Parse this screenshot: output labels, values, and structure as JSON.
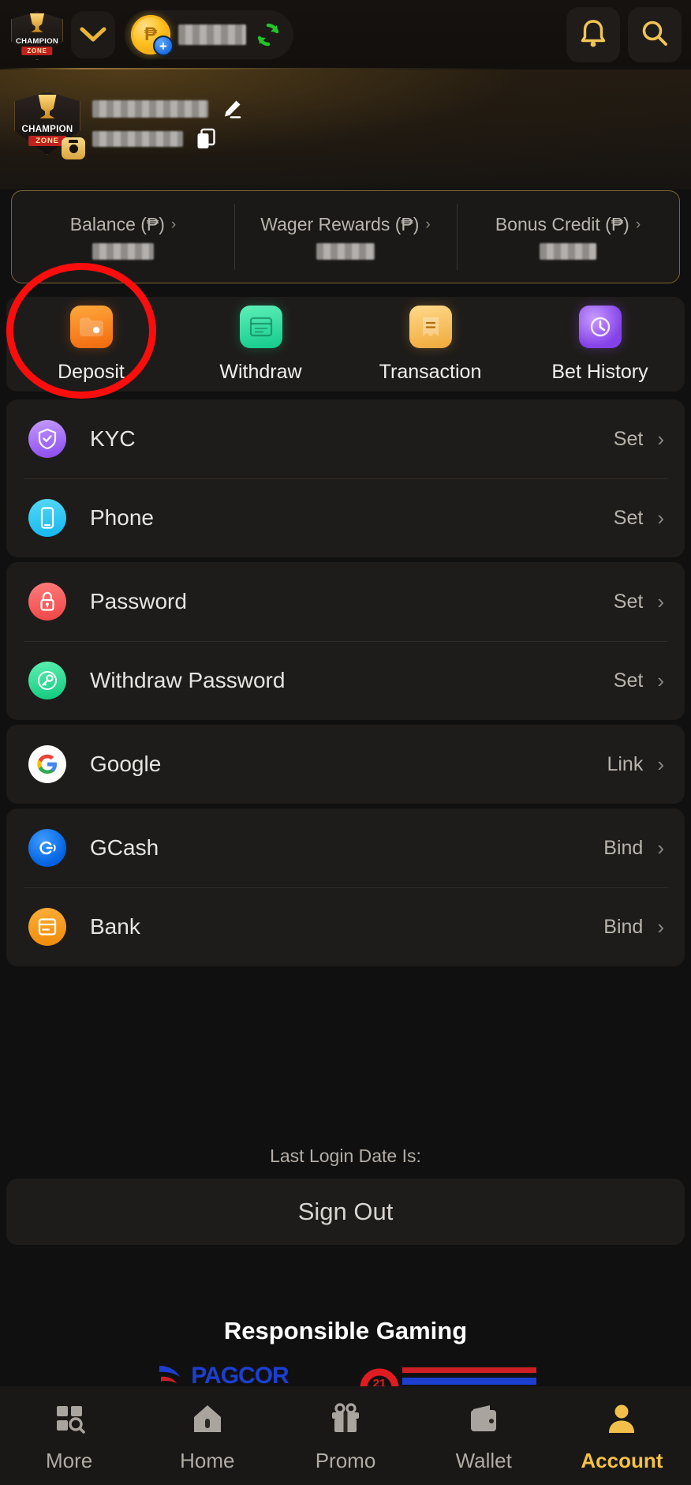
{
  "app": {
    "brand_name": "CHAMPION",
    "brand_sub": "ZONE",
    "currency_symbol": "₱",
    "accent_gold": "#f5c243",
    "annotation_color": "#f90d0d"
  },
  "topbar": {
    "brand_logo_label": "CHAMPION ZONE",
    "dropdown_label": "chevron-down",
    "wallet": {
      "coin_symbol": "₱",
      "add_badge": "+",
      "amount_value": "",
      "refresh_label": "refresh"
    },
    "notification_label": "notifications",
    "search_label": "search"
  },
  "profile": {
    "avatar_label": "CHAMPION ZONE",
    "camera_label": "change avatar",
    "username": "",
    "user_id": "",
    "edit_label": "edit nickname",
    "copy_label": "copy user id"
  },
  "balance_card": {
    "cells": [
      {
        "label": "Balance (₱)",
        "chevron": "›",
        "value": ""
      },
      {
        "label": "Wager Rewards (₱)",
        "chevron": "›",
        "value": ""
      },
      {
        "label": "Bonus Credit (₱)",
        "chevron": "›",
        "value": ""
      }
    ]
  },
  "quick_actions": [
    {
      "label": "Deposit",
      "icon": "wallet-deposit-icon",
      "highlighted": true
    },
    {
      "label": "Withdraw",
      "icon": "cash-withdraw-icon",
      "highlighted": false
    },
    {
      "label": "Transaction",
      "icon": "receipt-transaction-icon",
      "highlighted": false
    },
    {
      "label": "Bet History",
      "icon": "clock-history-icon",
      "highlighted": false
    }
  ],
  "settings_groups": [
    {
      "rows": [
        {
          "label": "KYC",
          "status": "Set",
          "chevron": "›",
          "icon": "shield-check-icon"
        },
        {
          "label": "Phone",
          "status": "Set",
          "chevron": "›",
          "icon": "phone-icon"
        }
      ]
    },
    {
      "rows": [
        {
          "label": "Password",
          "status": "Set",
          "chevron": "›",
          "icon": "lock-icon"
        },
        {
          "label": "Withdraw Password",
          "status": "Set",
          "chevron": "›",
          "icon": "key-icon"
        }
      ]
    },
    {
      "rows": [
        {
          "label": "Google",
          "status": "Link",
          "chevron": "›",
          "icon": "google-icon"
        }
      ]
    },
    {
      "rows": [
        {
          "label": "GCash",
          "status": "Bind",
          "chevron": "›",
          "icon": "gcash-icon"
        },
        {
          "label": "Bank",
          "status": "Bind",
          "chevron": "›",
          "icon": "bank-card-icon"
        }
      ]
    }
  ],
  "footer": {
    "last_login_label": "Last Login Date Is:",
    "last_login_value": "",
    "sign_out_label": "Sign Out",
    "responsible_gaming_title": "Responsible Gaming",
    "partners": [
      {
        "name": "PAGCOR",
        "type": "regulator-logo"
      },
      {
        "name": "21",
        "type": "age-restriction-logo"
      }
    ]
  },
  "bottom_nav": {
    "items": [
      {
        "label": "More",
        "icon": "grid-search-icon",
        "active": false
      },
      {
        "label": "Home",
        "icon": "home-icon",
        "active": false
      },
      {
        "label": "Promo",
        "icon": "gift-icon",
        "active": false
      },
      {
        "label": "Wallet",
        "icon": "wallet-icon",
        "active": false
      },
      {
        "label": "Account",
        "icon": "user-icon",
        "active": true
      }
    ]
  }
}
